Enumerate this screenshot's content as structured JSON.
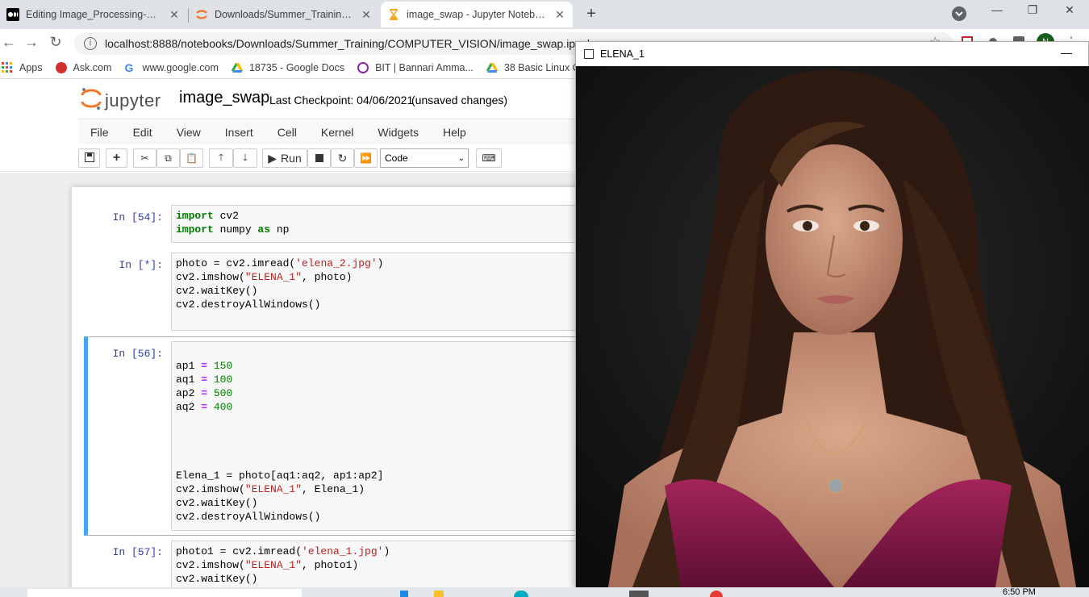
{
  "tabs": [
    {
      "title": "Editing Image_Processing-Compu",
      "icon": "medium-icon",
      "active": false
    },
    {
      "title": "Downloads/Summer_Training/CO",
      "icon": "jupyter-icon",
      "active": false
    },
    {
      "title": "image_swap - Jupyter Notebook",
      "icon": "hourglass-icon",
      "active": true
    }
  ],
  "window_controls": {
    "minimize": "—",
    "restore": "❐",
    "close": "✕"
  },
  "address": {
    "url": "localhost:8888/notebooks/Downloads/Summer_Training/COMPUTER_VISION/image_swap.ipynb"
  },
  "bookmarks": [
    {
      "label": "Apps",
      "icon": "apps-grid-icon",
      "color": "#ea4335"
    },
    {
      "label": "Ask.com",
      "icon": "ask-icon",
      "color": "#d32f2f"
    },
    {
      "label": "www.google.com",
      "icon": "google-icon",
      "color": "#4285f4"
    },
    {
      "label": "18735 - Google Docs",
      "icon": "drive-icon",
      "color": "#fbbc04"
    },
    {
      "label": "BIT | Bannari Amma...",
      "icon": "bit-icon",
      "color": "#8e24aa"
    },
    {
      "label": "38 Basic Linux Com",
      "icon": "drive-icon",
      "color": "#34a853"
    }
  ],
  "jupyter": {
    "logo_text": "jupyter",
    "notebook_name": "image_swap",
    "checkpoint": "Last Checkpoint: 04/06/2021",
    "unsaved": "(unsaved changes)",
    "menu": [
      "File",
      "Edit",
      "View",
      "Insert",
      "Cell",
      "Kernel",
      "Widgets",
      "Help"
    ],
    "run_label": "Run",
    "cell_type": "Code"
  },
  "cells": [
    {
      "prompt": "In [54]:",
      "lines": [
        "import cv2",
        "import numpy as np"
      ]
    },
    {
      "prompt": "In [*]:",
      "lines": [
        "photo = cv2.imread('elena_2.jpg')",
        "cv2.imshow(\"ELENA_1\", photo)",
        "cv2.waitKey()",
        "cv2.destroyAllWindows()",
        ""
      ]
    },
    {
      "prompt": "In [56]:",
      "lines": [
        "",
        "ap1 = 150",
        "aq1 = 100",
        "ap2 = 500",
        "aq2 = 400",
        "",
        "",
        "",
        "",
        "Elena_1 = photo[aq1:aq2, ap1:ap2]",
        "cv2.imshow(\"ELENA_1\", Elena_1)",
        "cv2.waitKey()",
        "cv2.destroyAllWindows()"
      ]
    },
    {
      "prompt": "In [57]:",
      "lines": [
        "photo1 = cv2.imread('elena_1.jpg')",
        "cv2.imshow(\"ELENA_1\", photo1)",
        "cv2.waitKey()"
      ]
    }
  ],
  "cv_window": {
    "title": "ELENA_1",
    "minimize": "—"
  },
  "taskbar": {
    "time": "6:50 PM"
  }
}
